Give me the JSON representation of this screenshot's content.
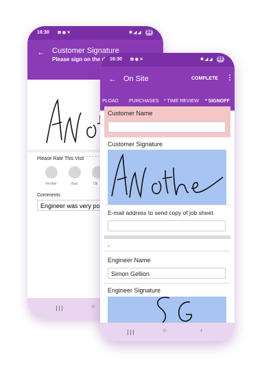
{
  "back_phone": {
    "status_time": "16:30",
    "status_battery": "23",
    "header_title": "Customer Signature",
    "header_subtitle": "Please sign on the d",
    "signature_text": "AN othe",
    "rating_label": "Please Rate This Visit",
    "rating_options": [
      "Terrible",
      "Bad",
      "Ok"
    ],
    "comments_label": "Comments",
    "comments_value": "Engineer was very po"
  },
  "front_phone": {
    "status_time": "16:30",
    "status_battery": "23",
    "header_title": "On Site",
    "complete_label": "COMPLETE",
    "tabs": [
      "PLOAD",
      "PURCHASES",
      "* TIME REVIEW",
      "* SIGNOFF"
    ],
    "customer_name_label": "Customer Name",
    "customer_name_value": "",
    "customer_signature_label": "Customer Signature",
    "customer_signature_text": "AN othe",
    "email_label": "E-mail address to send copy of job sheet",
    "email_value": "",
    "divider_text": "-",
    "engineer_name_label": "Engineer Name",
    "engineer_name_value": "Simon Gellion",
    "engineer_signature_label": "Engineer Signature",
    "engineer_signature_text": "SG"
  },
  "colors": {
    "header_purple": "#8a3bb5",
    "status_purple": "#7b2fa6",
    "nav_lavender": "#e9d5ef",
    "error_pink": "#f4c7c7",
    "signature_blue": "#a8c4f2"
  }
}
